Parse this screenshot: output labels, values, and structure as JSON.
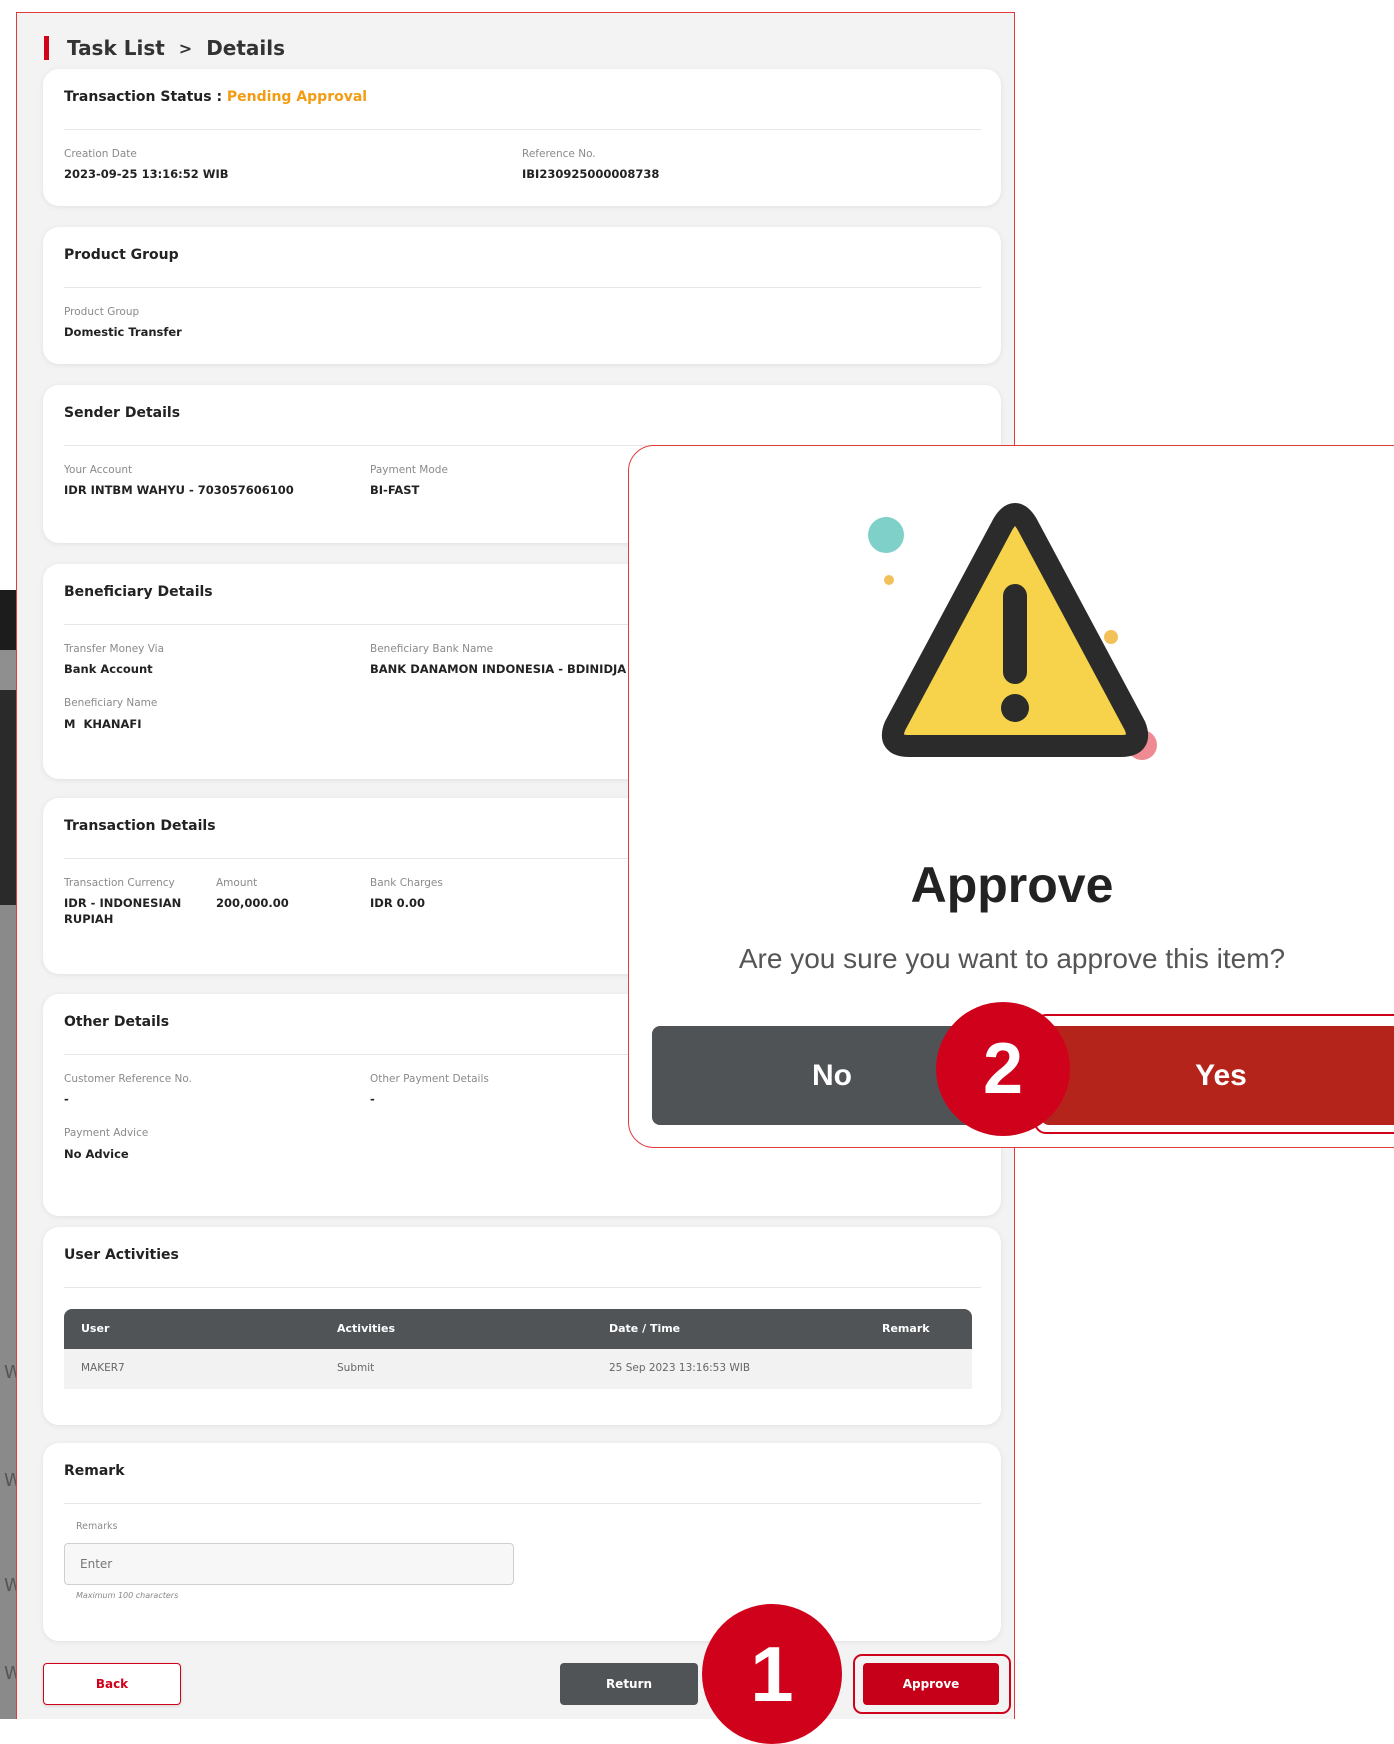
{
  "breadcrumb": {
    "parent": "Task List",
    "separator": ">",
    "current": "Details"
  },
  "status": {
    "label": "Transaction Status :",
    "value": "Pending Approval",
    "color": "#f39c12"
  },
  "summary": {
    "creation_date_label": "Creation Date",
    "creation_date": "2023-09-25 13:16:52 WIB",
    "reference_label": "Reference No.",
    "reference": "IBI230925000008738"
  },
  "product_group": {
    "title": "Product Group",
    "label": "Product Group",
    "value": "Domestic Transfer"
  },
  "sender": {
    "title": "Sender Details",
    "account_label": "Your Account",
    "account": "IDR INTBM WAHYU - 703057606100",
    "mode_label": "Payment Mode",
    "mode": "BI-FAST"
  },
  "beneficiary": {
    "title": "Beneficiary Details",
    "via_label": "Transfer Money Via",
    "via": "Bank Account",
    "bank_label": "Beneficiary Bank Name",
    "bank": "BANK DANAMON INDONESIA - BDINIDJA",
    "name_label": "Beneficiary Name",
    "name": "M  KHANAFI"
  },
  "transaction": {
    "title": "Transaction Details",
    "currency_label": "Transaction Currency",
    "currency_line1": "IDR - INDONESIAN",
    "currency_line2": "RUPIAH",
    "amount_label": "Amount",
    "amount": "200,000.00",
    "charges_label": "Bank Charges",
    "charges": "IDR 0.00"
  },
  "other": {
    "title": "Other Details",
    "cust_ref_label": "Customer Reference No.",
    "cust_ref": "-",
    "other_payment_label": "Other Payment Details",
    "other_payment": "-",
    "advice_label": "Payment Advice",
    "advice": "No Advice"
  },
  "activities": {
    "title": "User Activities",
    "columns": [
      "User",
      "Activities",
      "Date / Time",
      "Remark"
    ],
    "rows": [
      {
        "user": "MAKER7",
        "activity": "Submit",
        "datetime": "25 Sep 2023 13:16:53 WIB",
        "remark": ""
      }
    ]
  },
  "remark": {
    "title": "Remark",
    "field_label": "Remarks",
    "placeholder": "Enter",
    "hint": "Maximum 100 characters"
  },
  "buttons": {
    "back": "Back",
    "return": "Return",
    "approve": "Approve"
  },
  "background_strip": {
    "letters": [
      "W",
      "W",
      "W",
      "W"
    ]
  },
  "dialog": {
    "title": "Approve",
    "message": "Are you sure you want to approve this item?",
    "no": "No",
    "yes": "Yes",
    "icon": "warning-triangle-icon"
  },
  "steps": {
    "one": "1",
    "two": "2"
  },
  "colors": {
    "brand_red": "#d0021b",
    "button_dark": "#505457",
    "pending": "#f39c12",
    "yes_red": "#b5241b"
  }
}
